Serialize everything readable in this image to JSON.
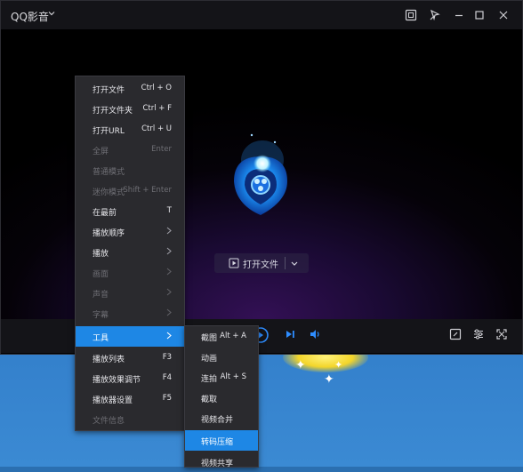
{
  "app": {
    "title": "QQ影音"
  },
  "open_button": {
    "label": "打开文件"
  },
  "main_menu": {
    "items": [
      {
        "label": "打开文件",
        "shortcut": "Ctrl + O",
        "state": "normal"
      },
      {
        "label": "打开文件夹",
        "shortcut": "Ctrl + F",
        "state": "normal"
      },
      {
        "label": "打开URL",
        "shortcut": "Ctrl + U",
        "state": "normal"
      },
      {
        "label": "全屏",
        "shortcut": "Enter",
        "state": "disabled"
      },
      {
        "label": "普通模式",
        "shortcut": "",
        "state": "disabled"
      },
      {
        "label": "迷你模式",
        "shortcut": "Shift + Enter",
        "state": "disabled"
      },
      {
        "label": "在最前",
        "shortcut": "T",
        "state": "normal"
      },
      {
        "label": "播放顺序",
        "shortcut": "",
        "state": "normal",
        "submenu": true
      },
      {
        "label": "播放",
        "shortcut": "",
        "state": "normal",
        "submenu": true
      },
      {
        "label": "画面",
        "shortcut": "",
        "state": "disabled",
        "submenu": true
      },
      {
        "label": "声音",
        "shortcut": "",
        "state": "disabled",
        "submenu": true
      },
      {
        "label": "字幕",
        "shortcut": "",
        "state": "disabled",
        "submenu": true
      },
      {
        "label": "工具",
        "shortcut": "",
        "state": "active",
        "submenu": true
      },
      {
        "label": "播放列表",
        "shortcut": "F3",
        "state": "normal"
      },
      {
        "label": "播放效果调节",
        "shortcut": "F4",
        "state": "normal"
      },
      {
        "label": "播放器设置",
        "shortcut": "F5",
        "state": "normal"
      },
      {
        "label": "文件信息",
        "shortcut": "",
        "state": "disabled"
      }
    ]
  },
  "tools_submenu": {
    "items": [
      {
        "label": "截图",
        "shortcut": "Alt + A",
        "state": "normal"
      },
      {
        "label": "动画",
        "shortcut": "",
        "state": "normal"
      },
      {
        "label": "连拍",
        "shortcut": "Alt + S",
        "state": "normal"
      },
      {
        "label": "截取",
        "shortcut": "",
        "state": "normal"
      },
      {
        "label": "视频合并",
        "shortcut": "",
        "state": "normal"
      },
      {
        "label": "转码压缩",
        "shortcut": "",
        "state": "active"
      },
      {
        "label": "视频共享",
        "shortcut": "",
        "state": "normal"
      }
    ]
  },
  "colors": {
    "accent": "#1e87e5",
    "menu_bg": "#2a2a2e",
    "titlebar_bg": "#141418",
    "disabled_text": "#6e6e74"
  },
  "icons": {
    "titlebar": [
      "screen-capture-icon",
      "pin-icon",
      "minimize-icon",
      "maximize-icon",
      "close-icon"
    ],
    "controls": [
      "play-icon",
      "next-icon",
      "volume-icon",
      "screenshot-icon",
      "equalizer-icon",
      "fullscreen-icon"
    ]
  }
}
